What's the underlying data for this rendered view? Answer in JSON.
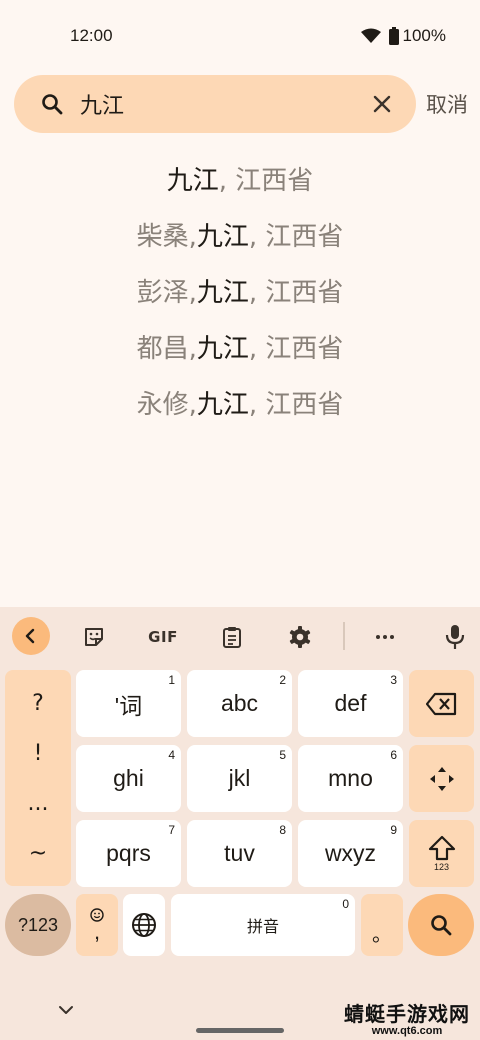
{
  "status_bar": {
    "time": "12:00",
    "battery": "100%"
  },
  "search": {
    "query": "九江",
    "cancel_label": "取消"
  },
  "results": [
    {
      "prefix": "",
      "main": "九江",
      "suffix": ", 江西省"
    },
    {
      "prefix": "柴桑, ",
      "main": "九江",
      "suffix": ", 江西省"
    },
    {
      "prefix": "彭泽, ",
      "main": "九江",
      "suffix": ", 江西省"
    },
    {
      "prefix": "都昌, ",
      "main": "九江",
      "suffix": ", 江西省"
    },
    {
      "prefix": "永修, ",
      "main": "九江",
      "suffix": ", 江西省"
    }
  ],
  "keyboard": {
    "toolbar": {
      "gif_label": "GIF",
      "more_label": "···"
    },
    "punctuation": [
      "?",
      "!",
      "...",
      "~"
    ],
    "keys": [
      {
        "label": "'词",
        "num": "1"
      },
      {
        "label": "abc",
        "num": "2"
      },
      {
        "label": "def",
        "num": "3"
      },
      {
        "label": "ghi",
        "num": "4"
      },
      {
        "label": "jkl",
        "num": "5"
      },
      {
        "label": "mno",
        "num": "6"
      },
      {
        "label": "pqrs",
        "num": "7"
      },
      {
        "label": "tuv",
        "num": "8"
      },
      {
        "label": "wxyz",
        "num": "9"
      }
    ],
    "shift_sub_label": "123",
    "mode_label": "?123",
    "emoji_comma_label": ",",
    "space_label": "拼音",
    "space_num": "0",
    "period_label": "。"
  },
  "watermark": {
    "title": "蜻蜓手游戏网",
    "url": "www.qt6.com"
  },
  "colors": {
    "accent": "#fbba7c",
    "pill": "#fdd8b5",
    "background": "#fef7f2",
    "keyboard_bg": "#f6e6dc"
  }
}
